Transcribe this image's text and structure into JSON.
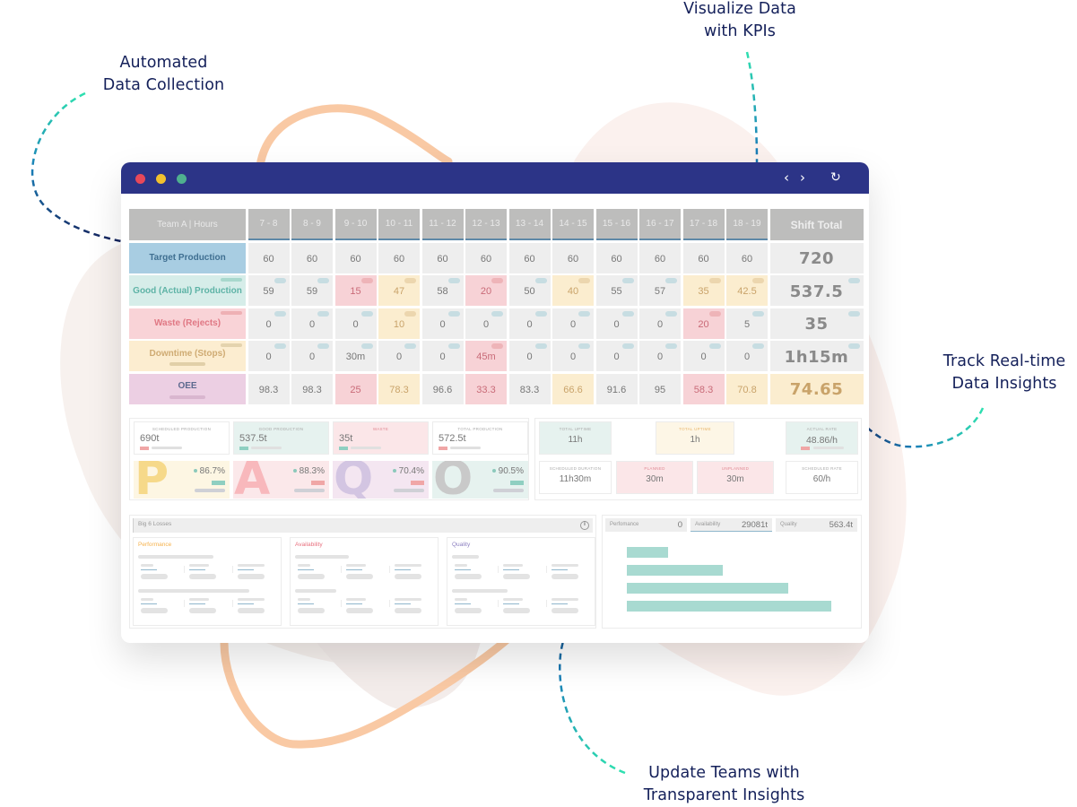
{
  "callouts": {
    "automated": [
      "Automated",
      "Data Collection"
    ],
    "visualize": [
      "Visualize Data",
      "with KPIs"
    ],
    "track": [
      "Track Real-time",
      "Data Insights"
    ],
    "update": [
      "Update Teams with",
      "Transparent Insights"
    ]
  },
  "colors": {
    "titlebar": "#2c3487",
    "accent_teal": "#a8dad1",
    "callout_text": "#14205a",
    "red_cell": "#f7d2d6",
    "yellow_cell": "#fbedcf"
  },
  "window": {
    "controls": {
      "back": "‹",
      "forward": "›",
      "refresh": "↻"
    }
  },
  "table": {
    "corner": "Team A | Hours",
    "hours": [
      "7 - 8",
      "8 - 9",
      "9 - 10",
      "10 - 11",
      "11 - 12",
      "12 - 13",
      "13 - 14",
      "14 - 15",
      "15 - 16",
      "16 - 17",
      "17 - 18",
      "18 - 19"
    ],
    "total_header": "Shift Total",
    "rows": [
      {
        "label": "Target Production",
        "values": [
          "60",
          "60",
          "60",
          "60",
          "60",
          "60",
          "60",
          "60",
          "60",
          "60",
          "60",
          "60"
        ],
        "status": [
          "",
          "",
          "",
          "",
          "",
          "",
          "",
          "",
          "",
          "",
          "",
          ""
        ],
        "total": "720",
        "total_status": ""
      },
      {
        "label": "Good (Actual) Production",
        "values": [
          "59",
          "59",
          "15",
          "47",
          "58",
          "20",
          "50",
          "40",
          "55",
          "57",
          "35",
          "42.5"
        ],
        "status": [
          "",
          "",
          "red",
          "yellow",
          "",
          "red",
          "",
          "yellow",
          "",
          "",
          "yellow",
          "yellow"
        ],
        "total": "537.5",
        "total_status": ""
      },
      {
        "label": "Waste (Rejects)",
        "values": [
          "0",
          "0",
          "0",
          "10",
          "0",
          "0",
          "0",
          "0",
          "0",
          "0",
          "20",
          "5"
        ],
        "status": [
          "",
          "",
          "",
          "yellow",
          "",
          "",
          "",
          "",
          "",
          "",
          "red",
          ""
        ],
        "total": "35",
        "total_status": ""
      },
      {
        "label": "Downtime (Stops)",
        "values": [
          "0",
          "0",
          "30m",
          "0",
          "0",
          "45m",
          "0",
          "0",
          "0",
          "0",
          "0",
          "0"
        ],
        "status": [
          "",
          "",
          "",
          "",
          "",
          "red",
          "",
          "",
          "",
          "",
          "",
          ""
        ],
        "total": "1h15m",
        "total_status": ""
      },
      {
        "label": "OEE",
        "values": [
          "98.3",
          "98.3",
          "25",
          "78.3",
          "96.6",
          "33.3",
          "83.3",
          "66.6",
          "91.6",
          "95",
          "58.3",
          "70.8"
        ],
        "status": [
          "",
          "",
          "red",
          "yellow",
          "",
          "red",
          "",
          "yellow",
          "",
          "",
          "red",
          "yellow"
        ],
        "total": "74.65",
        "total_status": "yellow"
      }
    ]
  },
  "kpis": {
    "production": [
      {
        "label": "Scheduled Production",
        "value": "690t"
      },
      {
        "label": "Good Production",
        "value": "537.5t"
      },
      {
        "label": "Waste",
        "value": "35t"
      },
      {
        "label": "Total Production",
        "value": "572.5t"
      }
    ],
    "letters": [
      {
        "letter": "P",
        "percent": "86.7%"
      },
      {
        "letter": "A",
        "percent": "88.3%"
      },
      {
        "letter": "Q",
        "percent": "70.4%"
      },
      {
        "letter": "O",
        "percent": "90.5%"
      }
    ],
    "time": {
      "total_uptime": {
        "label": "Total Uptime",
        "value": "11h"
      },
      "total_downtime": {
        "label": "Total Uptime",
        "value": "1h"
      },
      "actual_rate": {
        "label": "Actual Rate",
        "value": "48.86/h"
      },
      "scheduled_duration": {
        "label": "Scheduled Duration",
        "value": "11h30m"
      },
      "planned": {
        "label": "Planned",
        "value": "30m"
      },
      "unplanned": {
        "label": "Unplanned",
        "value": "30m"
      },
      "scheduled_rate": {
        "label": "Scheduled Rate",
        "value": "60/h"
      }
    }
  },
  "losses": {
    "title": "Big 6 Losses",
    "info_icon": "i",
    "cards": [
      "Performance",
      "Availability",
      "Quality"
    ]
  },
  "loss_chart": {
    "tabs": [
      {
        "name": "Perfomance",
        "value": "0"
      },
      {
        "name": "Availability",
        "value": "29081t"
      },
      {
        "name": "Quality",
        "value": "563.4t"
      }
    ],
    "active_tab": "Availability",
    "bar_fractions": [
      0.2,
      0.47,
      0.79,
      1.0
    ]
  }
}
